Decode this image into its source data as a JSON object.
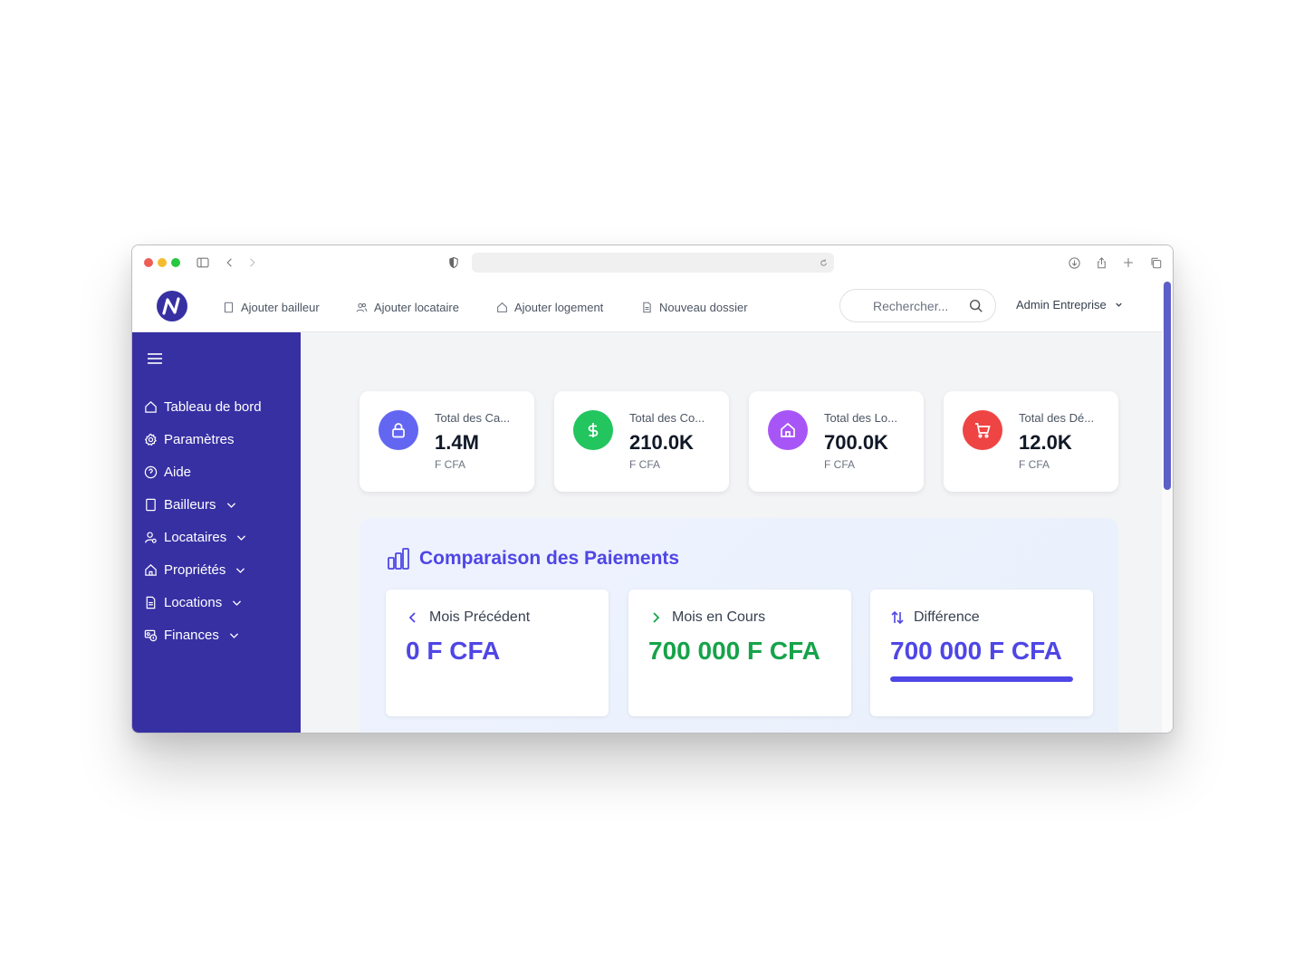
{
  "header": {
    "quick_links": [
      {
        "label": "Ajouter bailleur",
        "icon": "building-icon"
      },
      {
        "label": "Ajouter locataire",
        "icon": "users-icon"
      },
      {
        "label": "Ajouter logement",
        "icon": "home-icon"
      },
      {
        "label": "Nouveau dossier",
        "icon": "file-icon"
      }
    ],
    "search_placeholder": "Rechercher...",
    "user_label": "Admin Entreprise"
  },
  "sidebar": {
    "items": [
      {
        "label": "Tableau de bord",
        "icon": "home-icon",
        "has_submenu": false
      },
      {
        "label": "Paramètres",
        "icon": "gear-icon",
        "has_submenu": false
      },
      {
        "label": "Aide",
        "icon": "help-circle-icon",
        "has_submenu": false
      },
      {
        "label": "Bailleurs",
        "icon": "building-icon",
        "has_submenu": true
      },
      {
        "label": "Locataires",
        "icon": "user-icon",
        "has_submenu": true
      },
      {
        "label": "Propriétés",
        "icon": "home-icon",
        "has_submenu": true
      },
      {
        "label": "Locations",
        "icon": "file-icon",
        "has_submenu": true
      },
      {
        "label": "Finances",
        "icon": "finance-icon",
        "has_submenu": true
      }
    ]
  },
  "stats": [
    {
      "label": "Total des Ca...",
      "value": "1.4M",
      "unit": "F CFA",
      "icon": "lock-icon",
      "color": "#6366f1"
    },
    {
      "label": "Total des Co...",
      "value": "210.0K",
      "unit": "F CFA",
      "icon": "dollar-icon",
      "color": "#22c55e"
    },
    {
      "label": "Total des Lo...",
      "value": "700.0K",
      "unit": "F CFA",
      "icon": "home-icon",
      "color": "#a855f7"
    },
    {
      "label": "Total des Dé...",
      "value": "12.0K",
      "unit": "F CFA",
      "icon": "cart-icon",
      "color": "#ef4444"
    }
  ],
  "comparison": {
    "title": "Comparaison des Paiements",
    "cards": [
      {
        "label": "Mois Précédent",
        "value": "0 F CFA",
        "icon": "chevron-left-icon",
        "color": "#4f46e5"
      },
      {
        "label": "Mois en Cours",
        "value": "700 000 F CFA",
        "icon": "chevron-right-icon",
        "color": "#16a34a"
      },
      {
        "label": "Différence",
        "value": "700 000 F CFA",
        "icon": "arrows-updown-icon",
        "color": "#4f46e5",
        "progress": 1.0
      }
    ]
  },
  "colors": {
    "sidebar_bg": "#3730a3",
    "accent": "#4f46e5",
    "success": "#16a34a"
  }
}
